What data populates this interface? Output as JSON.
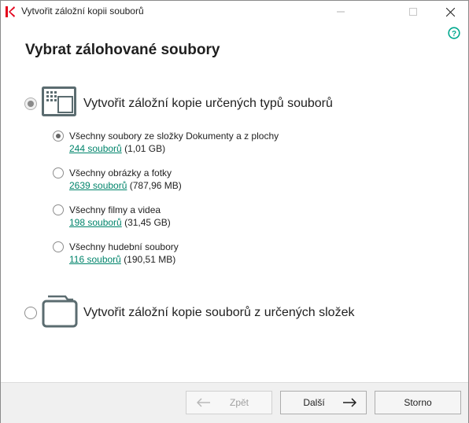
{
  "window": {
    "title": "Vytvořit záložní kopii souborů"
  },
  "page": {
    "title": "Vybrat zálohované soubory"
  },
  "option_types": {
    "label": "Vytvořit záložní kopie určených typů souborů",
    "selected": true,
    "sub_options": [
      {
        "label": "Všechny soubory ze složky Dokumenty a z plochy",
        "count": "244 souborů",
        "size": "(1,01 GB)",
        "selected": true
      },
      {
        "label": "Všechny obrázky a fotky",
        "count": "2639 souborů",
        "size": "(787,96 MB)",
        "selected": false
      },
      {
        "label": "Všechny filmy a videa",
        "count": "198 souborů",
        "size": "(31,45 GB)",
        "selected": false
      },
      {
        "label": "Všechny hudební soubory",
        "count": "116 souborů",
        "size": "(190,51 MB)",
        "selected": false
      }
    ]
  },
  "option_folders": {
    "label": "Vytvořit záložní kopie souborů z určených složek",
    "selected": false
  },
  "buttons": {
    "back": "Zpět",
    "next": "Další",
    "cancel": "Storno"
  },
  "colors": {
    "link": "#00846b",
    "accent": "#00a88e",
    "brand_red": "#e3001b"
  },
  "icons": {
    "app": "kaspersky-logo-icon",
    "help": "help-icon",
    "types": "window-grid-icon",
    "folders": "folder-icon",
    "back": "arrow-left-icon",
    "next": "arrow-right-icon"
  }
}
